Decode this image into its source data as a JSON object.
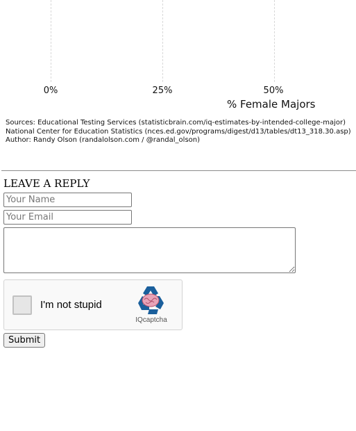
{
  "chart_data": {
    "type": "bar",
    "x_ticks": [
      "0%",
      "25%",
      "50%"
    ],
    "xlabel": "% Female Majors"
  },
  "sources": {
    "line1": "Sources: Educational Testing Services (statisticbrain.com/iq-estimates-by-intended-college-major)",
    "line2": "National Center for Education Statistics (nces.ed.gov/programs/digest/d13/tables/dt13_318.30.asp)",
    "line3": "Author: Randy Olson (randalolson.com / @randal_olson)"
  },
  "reply": {
    "heading": "LEAVE A REPLY",
    "name_placeholder": "Your Name",
    "email_placeholder": "Your Email",
    "comment_value": "",
    "captcha_label": "I'm not stupid",
    "captcha_brand": "IQcaptcha",
    "captcha_logo_icon": "recycle-brain-icon",
    "submit_label": "Submit"
  },
  "colors": {
    "logo_blue": "#1a5f9c",
    "brain_pink": "#e8a3b8"
  }
}
